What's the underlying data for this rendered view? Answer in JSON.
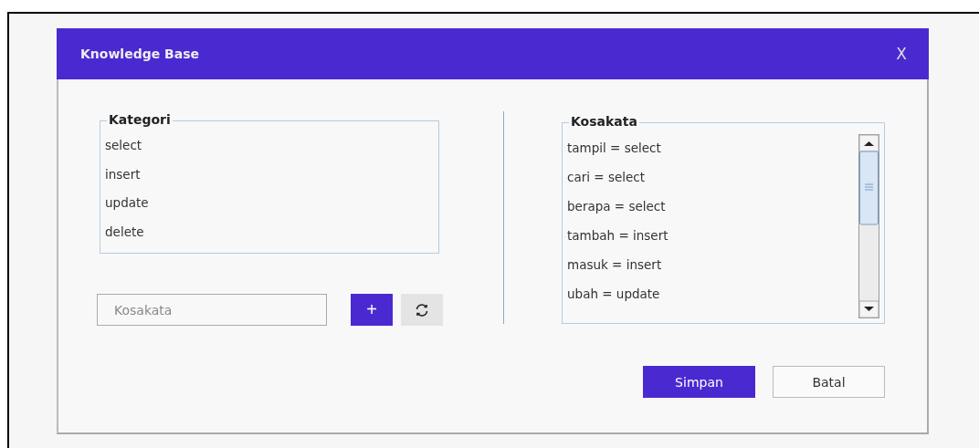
{
  "window": {
    "title": "Knowledge Base",
    "close": "X"
  },
  "kategori": {
    "legend": "Kategori",
    "items": [
      "select",
      "insert",
      "update",
      "delete"
    ]
  },
  "input": {
    "placeholder": "Kosakata"
  },
  "add_button": "+",
  "kosakata": {
    "legend": "Kosakata",
    "items": [
      "tampil = select",
      "cari = select",
      "berapa = select",
      "tambah = insert",
      "masuk = insert",
      "ubah = update"
    ]
  },
  "buttons": [
    {
      "label": "Simpan",
      "kind": "primary"
    },
    {
      "label": "Batal",
      "kind": "secondary"
    }
  ]
}
